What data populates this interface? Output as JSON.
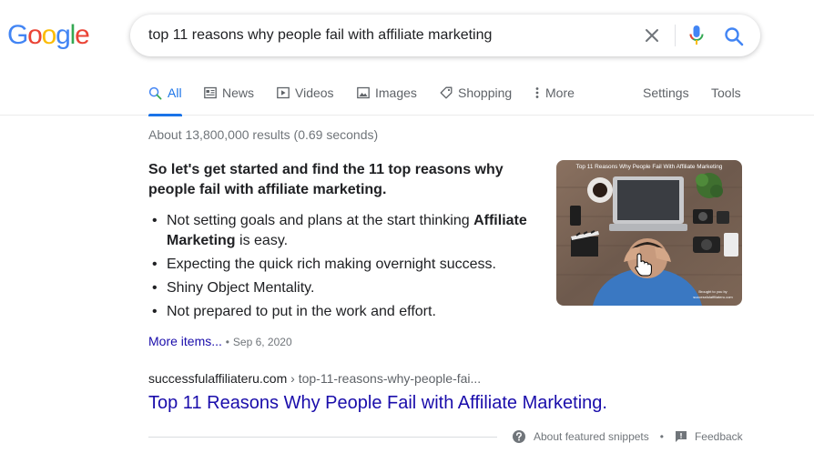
{
  "logo": {
    "letters": [
      "G",
      "o",
      "o",
      "g",
      "l",
      "e"
    ]
  },
  "search": {
    "query": "top 11 reasons why people fail with affiliate marketing"
  },
  "tabs": [
    {
      "label": "All",
      "icon": "search-icon",
      "active": true
    },
    {
      "label": "News",
      "icon": "news-icon"
    },
    {
      "label": "Videos",
      "icon": "video-icon"
    },
    {
      "label": "Images",
      "icon": "image-icon"
    },
    {
      "label": "Shopping",
      "icon": "tag-icon"
    },
    {
      "label": "More",
      "icon": "more-vert-icon"
    }
  ],
  "tools": {
    "settings": "Settings",
    "tools": "Tools"
  },
  "stats": "About 13,800,000 results (0.69 seconds)",
  "snippet": {
    "heading": "So let's get started and find the 11 top reasons why people fail with affiliate marketing.",
    "items": [
      {
        "pre": "Not setting goals and plans at the start thinking ",
        "bold": "Affiliate Marketing",
        "post": " is easy."
      },
      {
        "pre": "Expecting the quick rich making overnight success.",
        "bold": "",
        "post": ""
      },
      {
        "pre": "Shiny Object Mentality.",
        "bold": "",
        "post": ""
      },
      {
        "pre": "Not prepared to put in the work and effort.",
        "bold": "",
        "post": ""
      }
    ],
    "more_link": "More items...",
    "separator": "•",
    "date": "Sep 6, 2020",
    "image": {
      "caption": "Top 11 Reasons Why People Fail With Affiliate Marketing",
      "credit_line1": "Brought to you by",
      "credit_line2": "successfulaffiliateru.com"
    }
  },
  "result": {
    "domain": "successfulaffiliateru.com",
    "path": " › top-11-reasons-why-people-fai...",
    "title": "Top 11 Reasons Why People Fail with Affiliate Marketing."
  },
  "footer": {
    "about": "About featured snippets",
    "separator": "•",
    "feedback": "Feedback"
  },
  "colors": {
    "link": "#1a0dab",
    "accent": "#1a73e8",
    "google_blue": "#4285f4",
    "google_red": "#ea4335",
    "google_yellow": "#fbbc05",
    "google_green": "#34a853"
  }
}
